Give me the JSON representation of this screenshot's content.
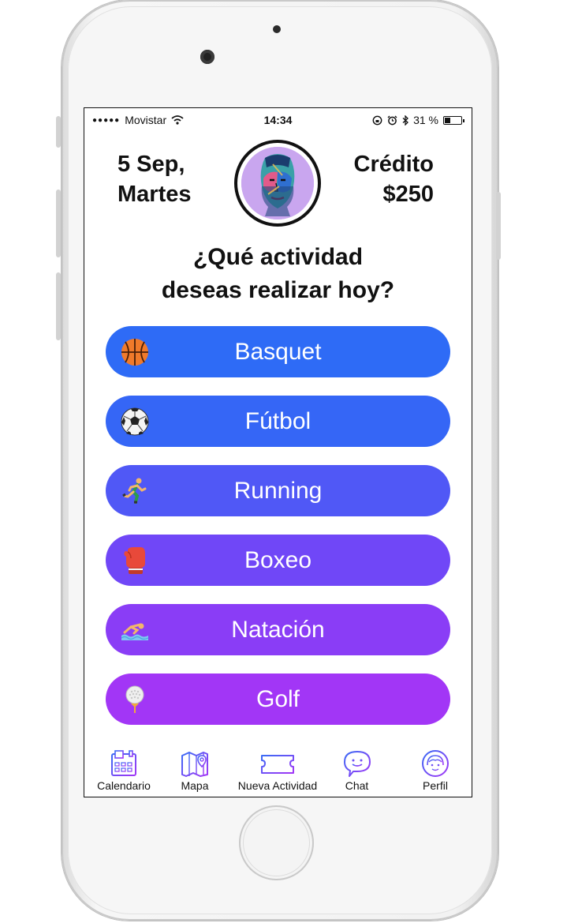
{
  "status_bar": {
    "carrier": "Movistar",
    "signal_dots": "●●●●●",
    "time": "14:34",
    "battery": "31 %"
  },
  "header": {
    "date_line1": "5 Sep,",
    "date_line2": "Martes",
    "credit_label": "Crédito",
    "credit_amount": "$250"
  },
  "question": {
    "line1": "¿Qué actividad",
    "line2": "deseas realizar hoy?"
  },
  "activities": [
    {
      "label": "Basquet",
      "icon": "basketball-icon",
      "color": "#2E6BF6"
    },
    {
      "label": "Fútbol",
      "icon": "soccer-ball-icon",
      "color": "#3566F6"
    },
    {
      "label": "Running",
      "icon": "runner-icon",
      "color": "#5058F6"
    },
    {
      "label": "Boxeo",
      "icon": "boxing-glove-icon",
      "color": "#7047F7"
    },
    {
      "label": "Natación",
      "icon": "swimmer-icon",
      "color": "#8A3DF6"
    },
    {
      "label": "Golf",
      "icon": "golf-ball-icon",
      "color": "#A236F6"
    }
  ],
  "tabbar": [
    {
      "label": "Calendario",
      "icon": "calendar-icon"
    },
    {
      "label": "Mapa",
      "icon": "map-icon"
    },
    {
      "label": "Nueva Actividad",
      "icon": "ticket-icon"
    },
    {
      "label": "Chat",
      "icon": "chat-bubble-icon"
    },
    {
      "label": "Perfil",
      "icon": "profile-face-icon"
    }
  ],
  "colors": {
    "icon_gradient_start": "#3A6BF5",
    "icon_gradient_end": "#A236F6"
  }
}
